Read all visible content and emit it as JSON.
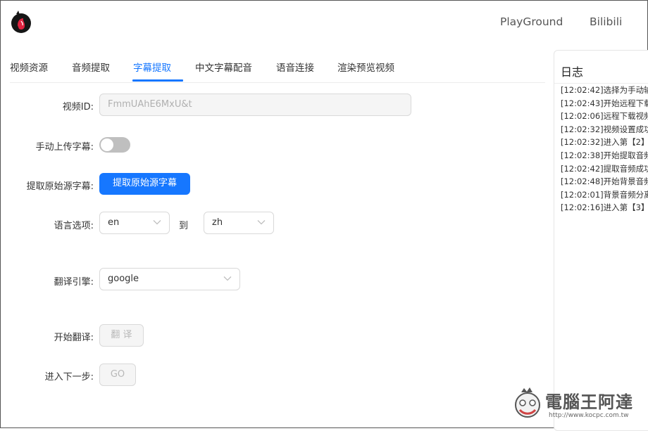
{
  "header": {
    "nav": [
      "PlayGround",
      "Bilibili"
    ]
  },
  "tabs": [
    "视频资源",
    "音频提取",
    "字幕提取",
    "中文字幕配音",
    "语音连接",
    "渲染预览视频"
  ],
  "form": {
    "video_id_label": "视频ID:",
    "video_id_value": "FmmUAhE6MxU&t",
    "manual_upload_label": "手动上传字幕:",
    "manual_upload_on": false,
    "extract_label": "提取原始源字幕:",
    "extract_button": "提取原始源字幕",
    "lang_label": "语言选项:",
    "lang_from": "en",
    "lang_to_word": "到",
    "lang_to": "zh",
    "engine_label": "翻译引擎:",
    "engine_value": "google",
    "translate_label": "开始翻译:",
    "translate_button": "翻 译",
    "next_label": "进入下一步:",
    "next_button": "GO"
  },
  "log": {
    "title": "日志",
    "lines": [
      "[12:02:42]选择为手动输",
      "[12:02:43]开始远程下载",
      "[12:02:06]远程下载视频",
      "[12:02:32]视频设置成功",
      "[12:02:32]进入第【2】",
      "[12:02:38]开始提取音频",
      "[12:02:42]提取音频成功",
      "[12:02:48]开始背景音频",
      "[12:02:01]背景音频分离",
      "[12:02:16]进入第【3】个"
    ]
  },
  "watermark": {
    "title": "電腦王阿達",
    "url": "http://www.kocpc.com.tw"
  },
  "colors": {
    "accent": "#1677ff",
    "logo_red": "#e0223f"
  }
}
